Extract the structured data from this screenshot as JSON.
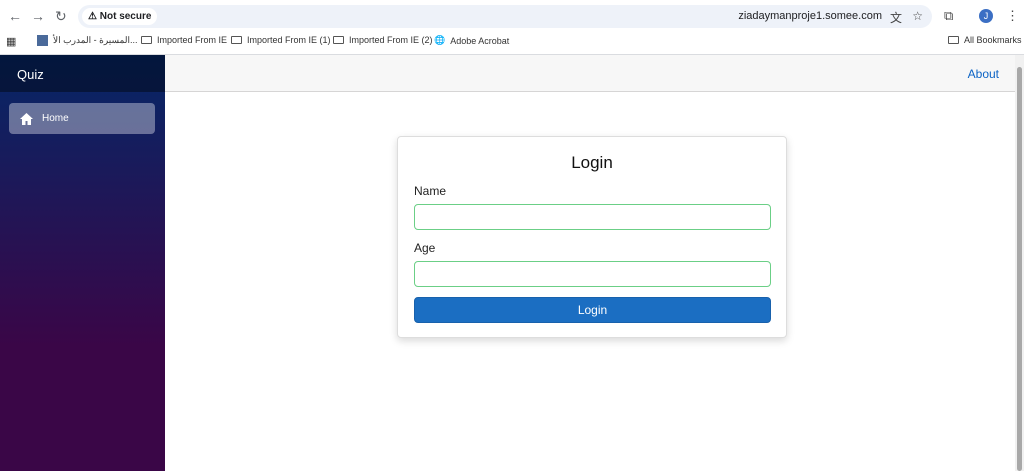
{
  "browser": {
    "security": "Not secure",
    "url": "ziadaymanproje1.somee.com",
    "profile_initial": "J",
    "bookmarks": [
      "المسيرة - المدرب الأ...",
      "Imported From IE",
      "Imported From IE (1)",
      "Imported From IE (2)",
      "Adobe Acrobat"
    ],
    "all_bookmarks": "All Bookmarks"
  },
  "sidebar": {
    "brand": "Quiz",
    "items": [
      {
        "label": "Home",
        "icon": "home-icon"
      }
    ]
  },
  "topbar": {
    "about": "About"
  },
  "login": {
    "title": "Login",
    "name_label": "Name",
    "name_value": "",
    "age_label": "Age",
    "age_value": "",
    "button": "Login"
  },
  "colors": {
    "accent": "#1b6ec2",
    "input_border": "#6bcf86",
    "sidebar_top": "#052767",
    "sidebar_bottom": "#3a0647"
  }
}
